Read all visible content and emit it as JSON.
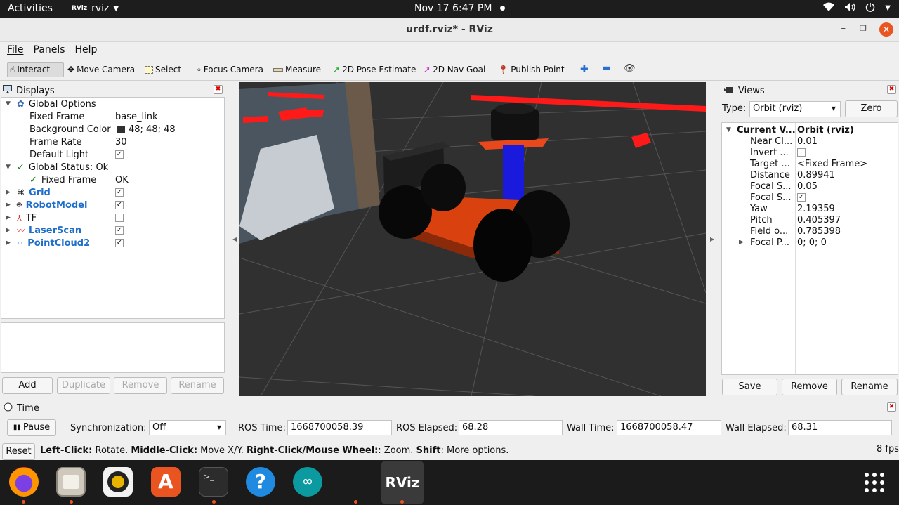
{
  "topbar": {
    "activities": "Activities",
    "app_name": "rviz",
    "clock": "Nov 17  6:47 PM"
  },
  "window": {
    "title": "urdf.rviz* - RViz"
  },
  "menu": [
    "File",
    "Panels",
    "Help"
  ],
  "toolbar": {
    "interact": "Interact",
    "move_camera": "Move Camera",
    "select": "Select",
    "focus_camera": "Focus Camera",
    "measure": "Measure",
    "pose_estimate": "2D Pose Estimate",
    "nav_goal": "2D Nav Goal",
    "publish_point": "Publish Point"
  },
  "displays": {
    "title": "Displays",
    "global_options": "Global Options",
    "fixed_frame_label": "Fixed Frame",
    "fixed_frame_value": "base_link",
    "bg_color_label": "Background Color",
    "bg_color_value": "48; 48; 48",
    "bg_color_swatch": "#303030",
    "frame_rate_label": "Frame Rate",
    "frame_rate_value": "30",
    "default_light_label": "Default Light",
    "global_status": "Global Status: Ok",
    "status_fixed_frame": "Fixed Frame",
    "status_fixed_frame_value": "OK",
    "items": [
      {
        "label": "Grid",
        "checked": true
      },
      {
        "label": "RobotModel",
        "checked": true
      },
      {
        "label": "TF",
        "checked": false
      },
      {
        "label": "LaserScan",
        "checked": true
      },
      {
        "label": "PointCloud2",
        "checked": true
      }
    ],
    "buttons": {
      "add": "Add",
      "duplicate": "Duplicate",
      "remove": "Remove",
      "rename": "Rename"
    }
  },
  "views": {
    "title": "Views",
    "type_label": "Type:",
    "type_value": "Orbit (rviz)",
    "zero": "Zero",
    "header_name": "Current V...",
    "header_value": "Orbit (rviz)",
    "props": [
      {
        "name": "Near Cl...",
        "value": "0.01"
      },
      {
        "name": "Invert ...",
        "value": ""
      },
      {
        "name": "Target ...",
        "value": "<Fixed Frame>"
      },
      {
        "name": "Distance",
        "value": "0.89941"
      },
      {
        "name": "Focal S...",
        "value": "0.05"
      },
      {
        "name": "Focal S...",
        "value": ""
      },
      {
        "name": "Yaw",
        "value": "2.19359"
      },
      {
        "name": "Pitch",
        "value": "0.405397"
      },
      {
        "name": "Field o...",
        "value": "0.785398"
      },
      {
        "name": "Focal P...",
        "value": "0; 0; 0"
      }
    ],
    "buttons": {
      "save": "Save",
      "remove": "Remove",
      "rename": "Rename"
    }
  },
  "time": {
    "title": "Time",
    "pause": "Pause",
    "sync_label": "Synchronization:",
    "sync_value": "Off",
    "ros_time_label": "ROS Time:",
    "ros_time": "1668700058.39",
    "ros_elapsed_label": "ROS Elapsed:",
    "ros_elapsed": "68.28",
    "wall_time_label": "Wall Time:",
    "wall_time": "1668700058.47",
    "wall_elapsed_label": "Wall Elapsed:",
    "wall_elapsed": "68.31"
  },
  "status": {
    "reset": "Reset",
    "left_click": "Left-Click:",
    "left_desc": " Rotate. ",
    "middle_click": "Middle-Click:",
    "middle_desc": " Move X/Y. ",
    "right_click": "Right-Click/Mouse Wheel:",
    "right_desc": ": Zoom. ",
    "shift": "Shift",
    "shift_desc": ": More options.",
    "fps": "8 fps"
  },
  "colors": {
    "accent": "#e95420",
    "link": "#1e6ecb"
  }
}
